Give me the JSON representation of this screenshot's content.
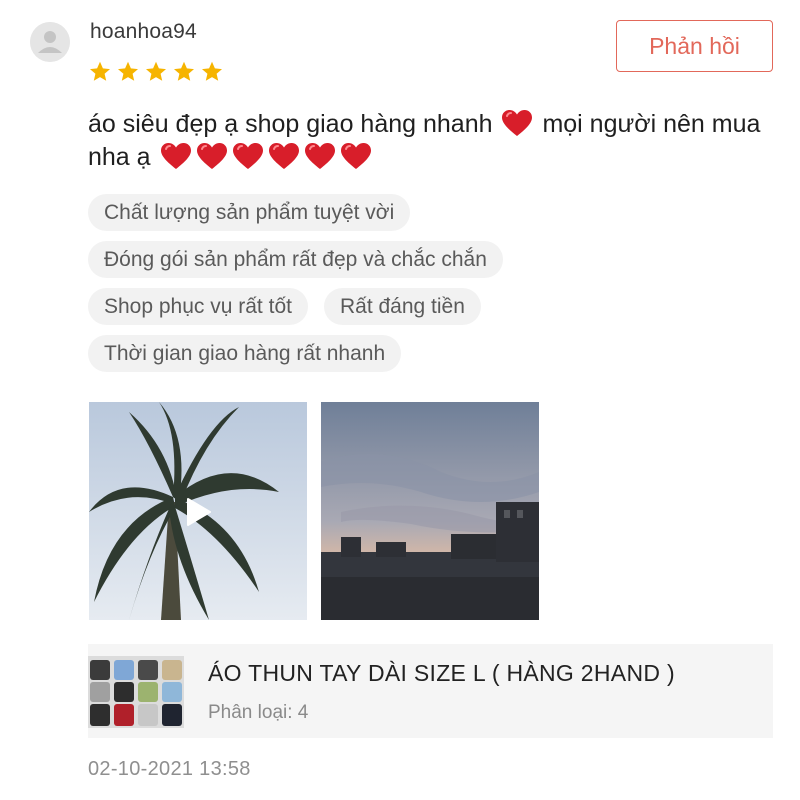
{
  "review": {
    "username": "hoanhoa94",
    "rating": 5,
    "rating_max": 5,
    "reply_label": "Phản hồi",
    "text_part1": "áo siêu đẹp ạ shop giao hàng nhanh",
    "text_part2": "mọi người nên mua nha ạ",
    "trailing_hearts": 6,
    "tags": [
      [
        "Chất lượng sản phẩm tuyệt vời"
      ],
      [
        "Đóng gói sản phẩm rất đẹp và chắc chắn"
      ],
      [
        "Shop phục vụ rất tốt",
        "Rất đáng tiền"
      ],
      [
        "Thời gian giao hàng rất nhanh"
      ]
    ],
    "media": [
      {
        "kind": "video",
        "subject": "palm tree"
      },
      {
        "kind": "image",
        "subject": "evening sky street"
      }
    ],
    "timestamp": "02-10-2021 13:58"
  },
  "product": {
    "name": "ÁO THUN TAY DÀI SIZE L ( HÀNG 2HAND )",
    "variant": "Phân loại: 4"
  },
  "icons": {
    "avatar": "user-avatar-icon",
    "star": "star-icon",
    "heart": "heart-icon",
    "play": "play-icon"
  },
  "colors": {
    "accent": "#e2685a",
    "star": "#f6b400",
    "heart": "#d81e2a",
    "tag_bg": "#f2f2f2",
    "card_bg": "#f5f5f5"
  }
}
